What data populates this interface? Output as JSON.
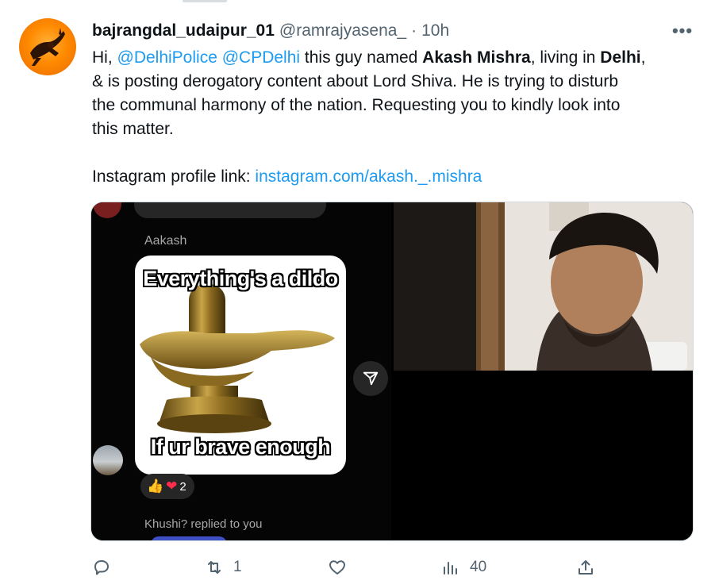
{
  "tweet": {
    "display_name": "bajrangdal_udaipur_01",
    "handle": "@ramrajyasena_",
    "separator": "·",
    "time": "10h",
    "more_label": "•••",
    "line1": {
      "t1": "Hi, ",
      "m1": "@DelhiPolice",
      "t2": " ",
      "m2": "@CPDelhi",
      "t3": " this guy named ",
      "b1": "Akash Mishra",
      "t4": ", living in ",
      "b2": "Delhi",
      "t5": ","
    },
    "line2": "& is posting derogatory content about Lord Shiva. He is trying to disturb",
    "line3": "the communal harmony of the nation. Requesting you to kindly look into",
    "line4": "this matter.",
    "link_prefix": "Instagram profile link: ",
    "link_text": "instagram.com/akash._.mishra"
  },
  "media": {
    "chat_sender": "Aakash",
    "meme_top": "Everything's a dildo",
    "meme_bottom": "If ur brave enough",
    "reaction_emojis": [
      "👍",
      "❤"
    ],
    "reaction_count": "2",
    "reply_note": "Khushi? replied to you"
  },
  "actions": {
    "reply_count": "",
    "retweet_count": "1",
    "like_count": "",
    "views_count": "40"
  },
  "icons": {
    "more": "more-icon",
    "reply": "reply-icon",
    "retweet": "retweet-icon",
    "like": "like-icon",
    "views": "views-icon",
    "share": "share-icon",
    "send": "send-icon"
  },
  "colors": {
    "link": "#1d9bf0",
    "text": "#0f1419",
    "muted": "#536471",
    "avatar_orange": "#ff8a00"
  }
}
